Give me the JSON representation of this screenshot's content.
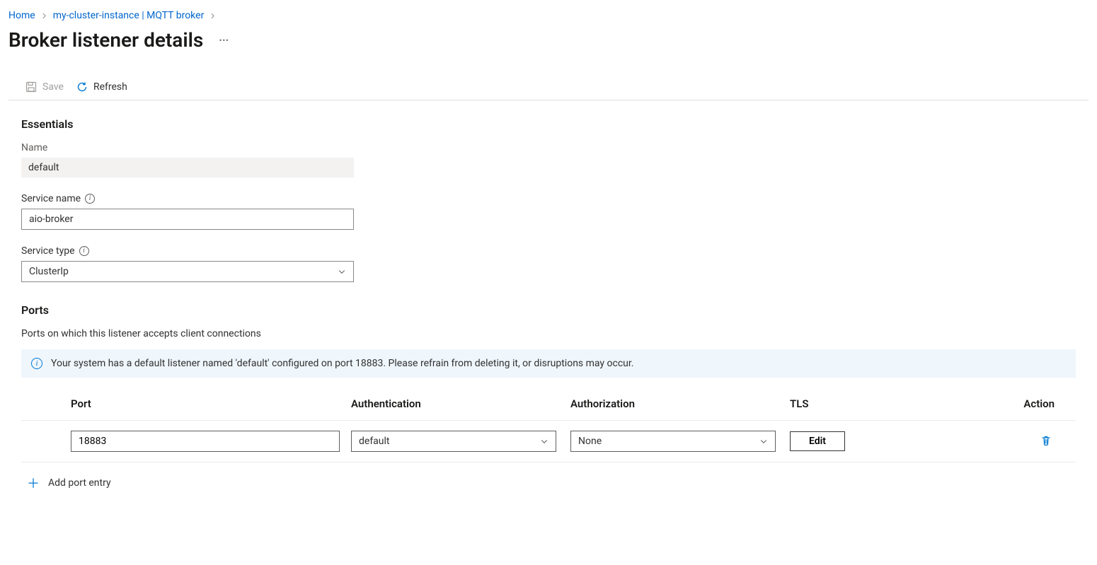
{
  "breadcrumb": {
    "home": "Home",
    "instance": "my-cluster-instance | MQTT broker"
  },
  "page": {
    "title": "Broker listener details"
  },
  "toolbar": {
    "save": "Save",
    "refresh": "Refresh"
  },
  "essentials": {
    "heading": "Essentials",
    "name_label": "Name",
    "name_value": "default",
    "service_name_label": "Service name",
    "service_name_value": "aio-broker",
    "service_type_label": "Service type",
    "service_type_value": "ClusterIp"
  },
  "ports": {
    "heading": "Ports",
    "description": "Ports on which this listener accepts client connections",
    "banner": "Your system has a default listener named 'default' configured on port 18883. Please refrain from deleting it, or disruptions may occur.",
    "columns": {
      "port": "Port",
      "authentication": "Authentication",
      "authorization": "Authorization",
      "tls": "TLS",
      "action": "Action"
    },
    "rows": [
      {
        "port": "18883",
        "authentication": "default",
        "authorization": "None",
        "tls": "Edit"
      }
    ],
    "add_label": "Add port entry"
  }
}
